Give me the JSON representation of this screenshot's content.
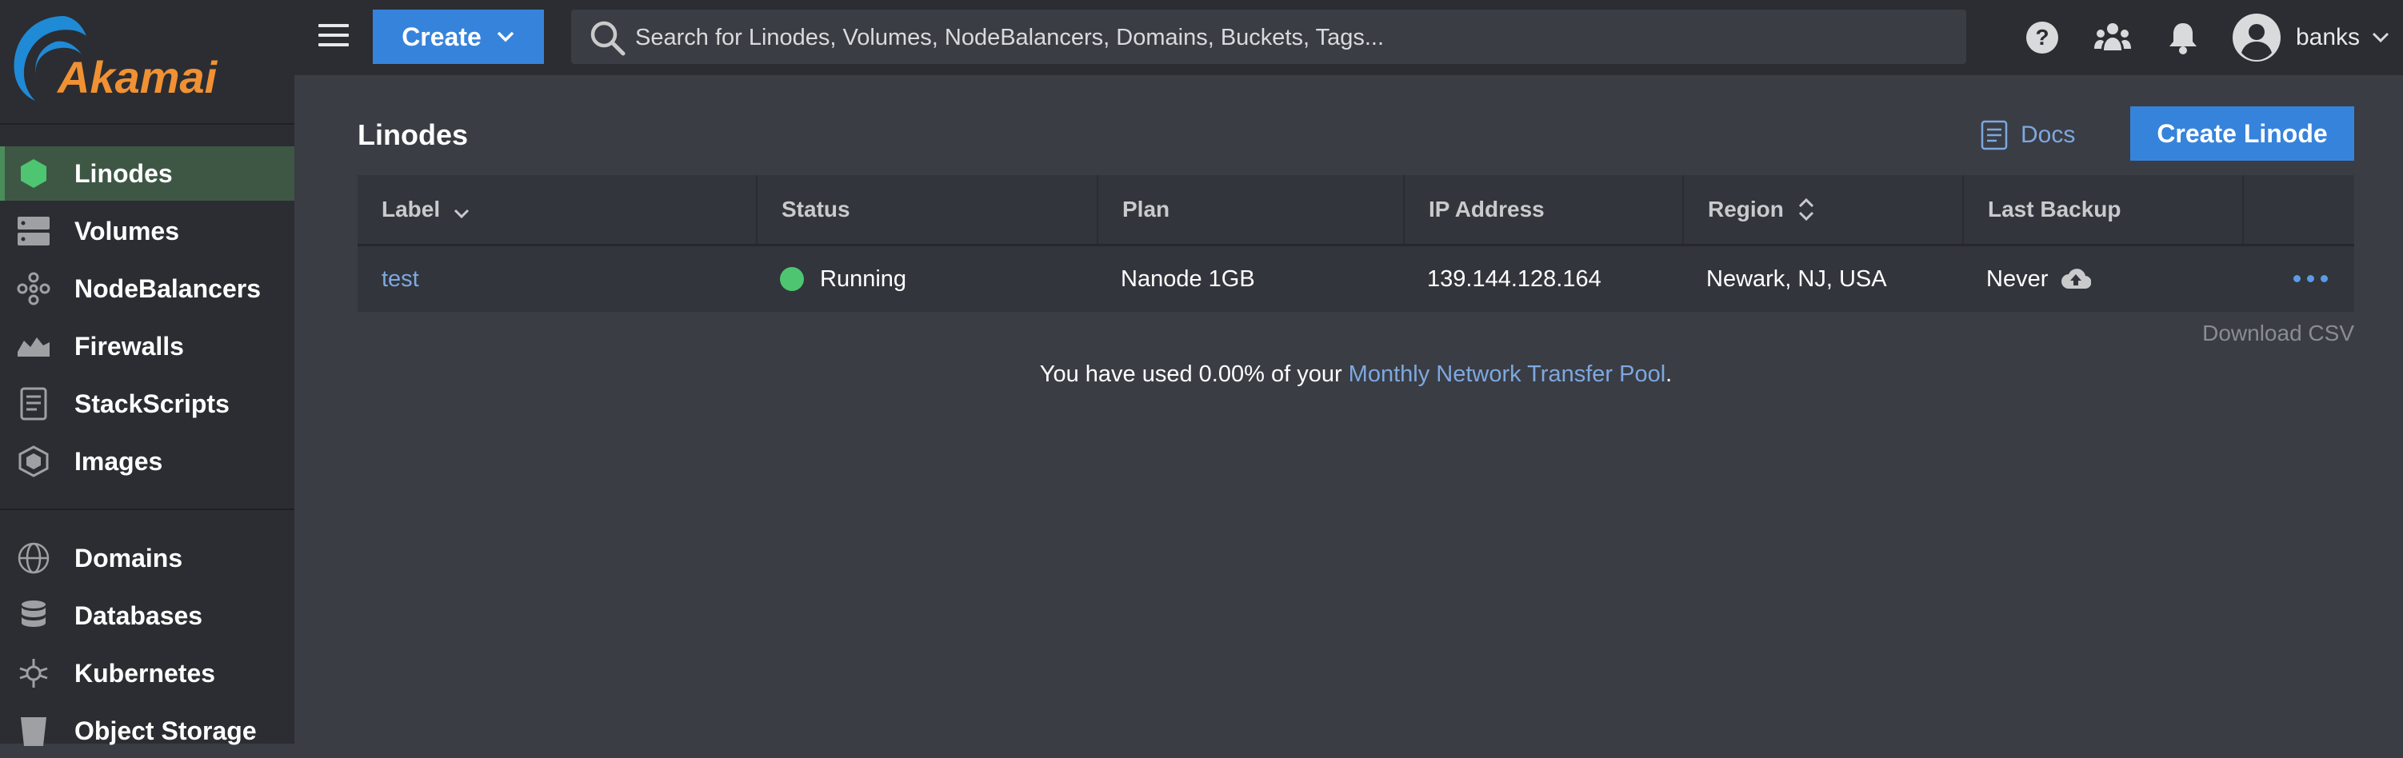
{
  "brand": {
    "logo_text": "Akamai",
    "accent": "#f09133"
  },
  "colors": {
    "primary": "#3683dc",
    "link": "#7ea8e0",
    "running": "#4ec571"
  },
  "sidebar": {
    "items": [
      {
        "label": "Linodes",
        "icon": "linodes-icon",
        "active": true
      },
      {
        "label": "Volumes",
        "icon": "volumes-icon"
      },
      {
        "label": "NodeBalancers",
        "icon": "nodebalancers-icon"
      },
      {
        "label": "Firewalls",
        "icon": "firewalls-icon"
      },
      {
        "label": "StackScripts",
        "icon": "stackscripts-icon"
      },
      {
        "label": "Images",
        "icon": "images-icon"
      },
      {
        "label": "Domains",
        "icon": "domains-icon"
      },
      {
        "label": "Databases",
        "icon": "databases-icon"
      },
      {
        "label": "Kubernetes",
        "icon": "kubernetes-icon"
      },
      {
        "label": "Object Storage",
        "icon": "object-storage-icon"
      }
    ]
  },
  "topbar": {
    "create_label": "Create",
    "search_placeholder": "Search for Linodes, Volumes, NodeBalancers, Domains, Buckets, Tags...",
    "username": "banks"
  },
  "main": {
    "title": "Linodes",
    "docs_label": "Docs",
    "create_linode_label": "Create Linode",
    "table": {
      "columns": [
        "Label",
        "Status",
        "Plan",
        "IP Address",
        "Region",
        "Last Backup"
      ],
      "rows": [
        {
          "label": "test",
          "status": "Running",
          "plan": "Nanode 1GB",
          "ip": "139.144.128.164",
          "region": "Newark, NJ, USA",
          "backup": "Never"
        }
      ]
    },
    "download_csv": "Download CSV",
    "usage": {
      "prefix": "You have used 0.00% of your ",
      "link": "Monthly Network Transfer Pool",
      "suffix": "."
    }
  }
}
